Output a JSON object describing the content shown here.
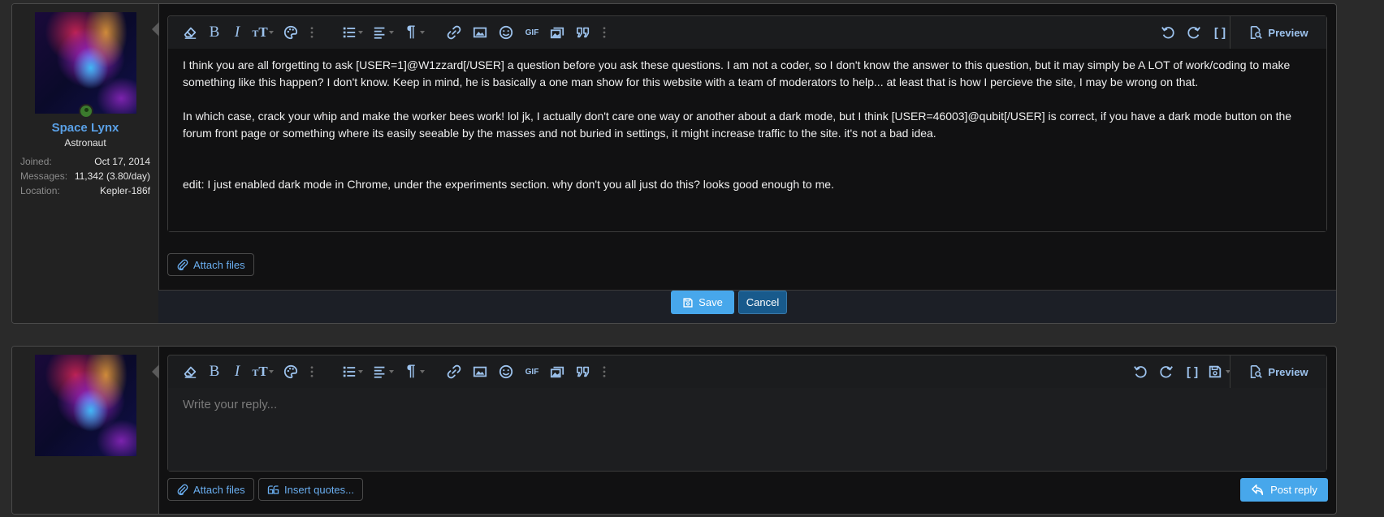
{
  "post_edit": {
    "user": {
      "name": "Space Lynx",
      "title": "Astronaut",
      "stats": [
        {
          "label": "Joined:",
          "value": "Oct 17, 2014"
        },
        {
          "label": "Messages:",
          "value": "11,342 (3.80/day)"
        },
        {
          "label": "Location:",
          "value": "Kepler-186f"
        }
      ]
    },
    "toolbar": {
      "preview_label": "Preview"
    },
    "content": {
      "paragraphs": [
        "I think you are all forgetting to ask [USER=1]@W1zzard[/USER] a question before you ask these questions. I am not a coder, so I don't know the answer to this question, but it may simply be A LOT of work/coding to make something like this happen? I don't know. Keep in mind, he is basically a one man show for this website with a team of moderators to help... at least that is how I percieve the site, I may be wrong on that.",
        "In which case, crack your whip and make the worker bees work! lol jk, I actually don't care one way or another about a dark mode, but I think [USER=46003]@qubit[/USER] is correct, if you have a dark mode button on the forum front page or something where its easily seeable by the masses and not buried in settings, it might increase traffic to the site. it's not a bad idea.",
        "edit:  I just enabled dark mode in Chrome, under the experiments section. why don't you all just do this? looks good enough to me."
      ]
    },
    "attach_label": "Attach files",
    "save_label": "Save",
    "cancel_label": "Cancel"
  },
  "reply": {
    "toolbar": {
      "preview_label": "Preview"
    },
    "placeholder": "Write your reply...",
    "attach_label": "Attach files",
    "insert_quotes_label": "Insert quotes...",
    "post_reply_label": "Post reply"
  },
  "icons": {
    "gif_text": "GIF",
    "paragraph_glyph": "¶"
  },
  "colors": {
    "accent": "#47a7eb",
    "link_blue": "#5aa0e6",
    "icon_blue": "#9dc3ee",
    "online_green": "#3b7a2d",
    "cancel_blue": "#185a8c"
  }
}
